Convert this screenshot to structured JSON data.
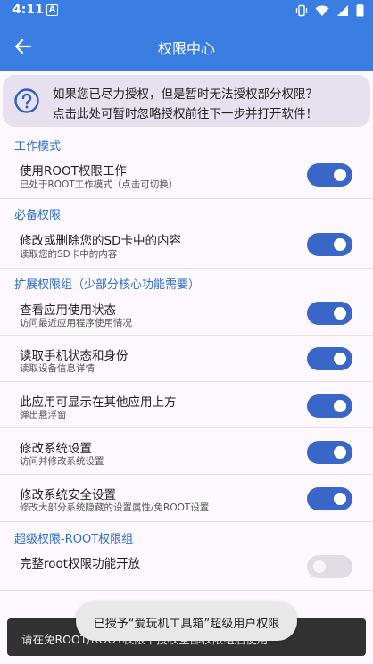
{
  "status_bar": {
    "time": "4:11",
    "notification_letter": "A"
  },
  "app_bar": {
    "title": "权限中心"
  },
  "notice": {
    "line1": "如果您已尽力授权，但是暂时无法授权部分权限？",
    "line2": "点击此处可暂时忽略授权前往下一步并打开软件！"
  },
  "sections": {
    "work_mode": {
      "title": "工作模式",
      "items": [
        {
          "label": "使用ROOT权限工作",
          "desc": "已处于ROOT工作模式（点击可切换）",
          "enabled": true
        }
      ]
    },
    "required": {
      "title": "必备权限",
      "items": [
        {
          "label": "修改或删除您的SD卡中的内容",
          "desc": "读取您的SD卡中的内容",
          "enabled": true
        }
      ]
    },
    "extended": {
      "title": "扩展权限组（少部分核心功能需要）",
      "items": [
        {
          "label": "查看应用使用状态",
          "desc": "访问最近应用程序使用情况",
          "enabled": true
        },
        {
          "label": "读取手机状态和身份",
          "desc": "读取设备信息详情",
          "enabled": true
        },
        {
          "label": "此应用可显示在其他应用上方",
          "desc": "弹出悬浮窗",
          "enabled": true
        },
        {
          "label": "修改系统设置",
          "desc": "访问并修改系统设置",
          "enabled": true
        },
        {
          "label": "修改系统安全设置",
          "desc": "修改大部分系统隐藏的设置属性/免ROOT设置",
          "enabled": true
        }
      ]
    },
    "super": {
      "title": "超级权限-ROOT权限组",
      "items": [
        {
          "label": "完整root权限功能开放",
          "desc": "",
          "enabled": false
        }
      ]
    }
  },
  "snackbar": {
    "text": "请在免ROOT/ROOT权限下授权全部权限组后使用"
  },
  "toast": {
    "text": "已授予“爱玩机工具箱”超级用户权限"
  },
  "colors": {
    "primary": "#3a7ee4",
    "toggle_on": "#3a66c8",
    "section_title": "#2f6fcf",
    "background": "#fdf8fd"
  }
}
